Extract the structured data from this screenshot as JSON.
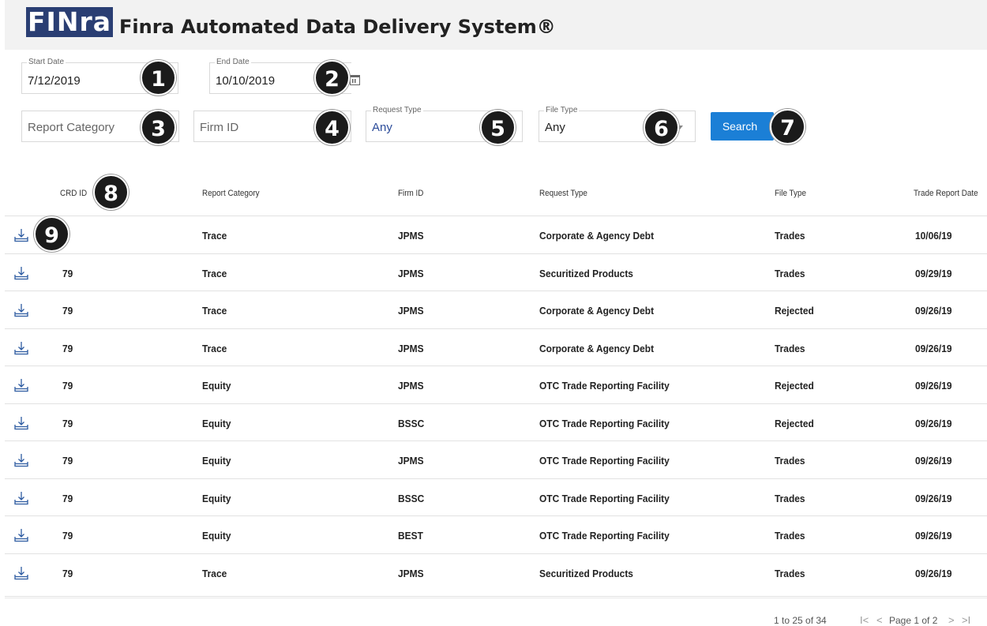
{
  "header": {
    "logo_text": "FINra",
    "title": "Finra Automated Data Delivery System®"
  },
  "filters": {
    "start_date": {
      "label": "Start Date",
      "value": "7/12/2019"
    },
    "end_date": {
      "label": "End Date",
      "value": "10/10/2019"
    },
    "report_category": {
      "placeholder": "Report Category"
    },
    "firm_id": {
      "placeholder": "Firm ID"
    },
    "request_type": {
      "label": "Request Type",
      "value": "Any"
    },
    "file_type": {
      "label": "File Type",
      "value": "Any"
    },
    "search_label": "Search"
  },
  "callouts": [
    "1",
    "2",
    "3",
    "4",
    "5",
    "6",
    "7",
    "8",
    "9"
  ],
  "table": {
    "columns": [
      "CRD ID",
      "Report Category",
      "Firm ID",
      "Request Type",
      "File Type",
      "Trade Report Date"
    ],
    "rows": [
      {
        "crd": "",
        "category": "Trace",
        "firm": "JPMS",
        "request": "Corporate & Agency Debt",
        "file": "Trades",
        "date": "10/06/19"
      },
      {
        "crd": "79",
        "category": "Trace",
        "firm": "JPMS",
        "request": "Securitized Products",
        "file": "Trades",
        "date": "09/29/19"
      },
      {
        "crd": "79",
        "category": "Trace",
        "firm": "JPMS",
        "request": "Corporate & Agency Debt",
        "file": "Rejected",
        "date": "09/26/19"
      },
      {
        "crd": "79",
        "category": "Trace",
        "firm": "JPMS",
        "request": "Corporate & Agency Debt",
        "file": "Trades",
        "date": "09/26/19"
      },
      {
        "crd": "79",
        "category": "Equity",
        "firm": "JPMS",
        "request": "OTC Trade Reporting Facility",
        "file": "Rejected",
        "date": "09/26/19"
      },
      {
        "crd": "79",
        "category": "Equity",
        "firm": "BSSC",
        "request": "OTC Trade Reporting Facility",
        "file": "Rejected",
        "date": "09/26/19"
      },
      {
        "crd": "79",
        "category": "Equity",
        "firm": "JPMS",
        "request": "OTC Trade Reporting Facility",
        "file": "Trades",
        "date": "09/26/19"
      },
      {
        "crd": "79",
        "category": "Equity",
        "firm": "BSSC",
        "request": "OTC Trade Reporting Facility",
        "file": "Trades",
        "date": "09/26/19"
      },
      {
        "crd": "79",
        "category": "Equity",
        "firm": "BEST",
        "request": "OTC Trade Reporting Facility",
        "file": "Trades",
        "date": "09/26/19"
      },
      {
        "crd": "79",
        "category": "Trace",
        "firm": "JPMS",
        "request": "Securitized Products",
        "file": "Trades",
        "date": "09/26/19"
      }
    ]
  },
  "pagination": {
    "range": "1 to 25 of 34",
    "first": "I<",
    "prev": "<",
    "page_text": "Page 1 of 2",
    "next": ">",
    "last": ">I"
  },
  "colors": {
    "accent": "#1b7fd6",
    "logo_bg": "#2a3e73",
    "badge": "#1b1b1b"
  },
  "icons": {
    "row_action": "download-icon",
    "date_picker": "calendar-icon",
    "dropdown": "caret-down-icon"
  }
}
